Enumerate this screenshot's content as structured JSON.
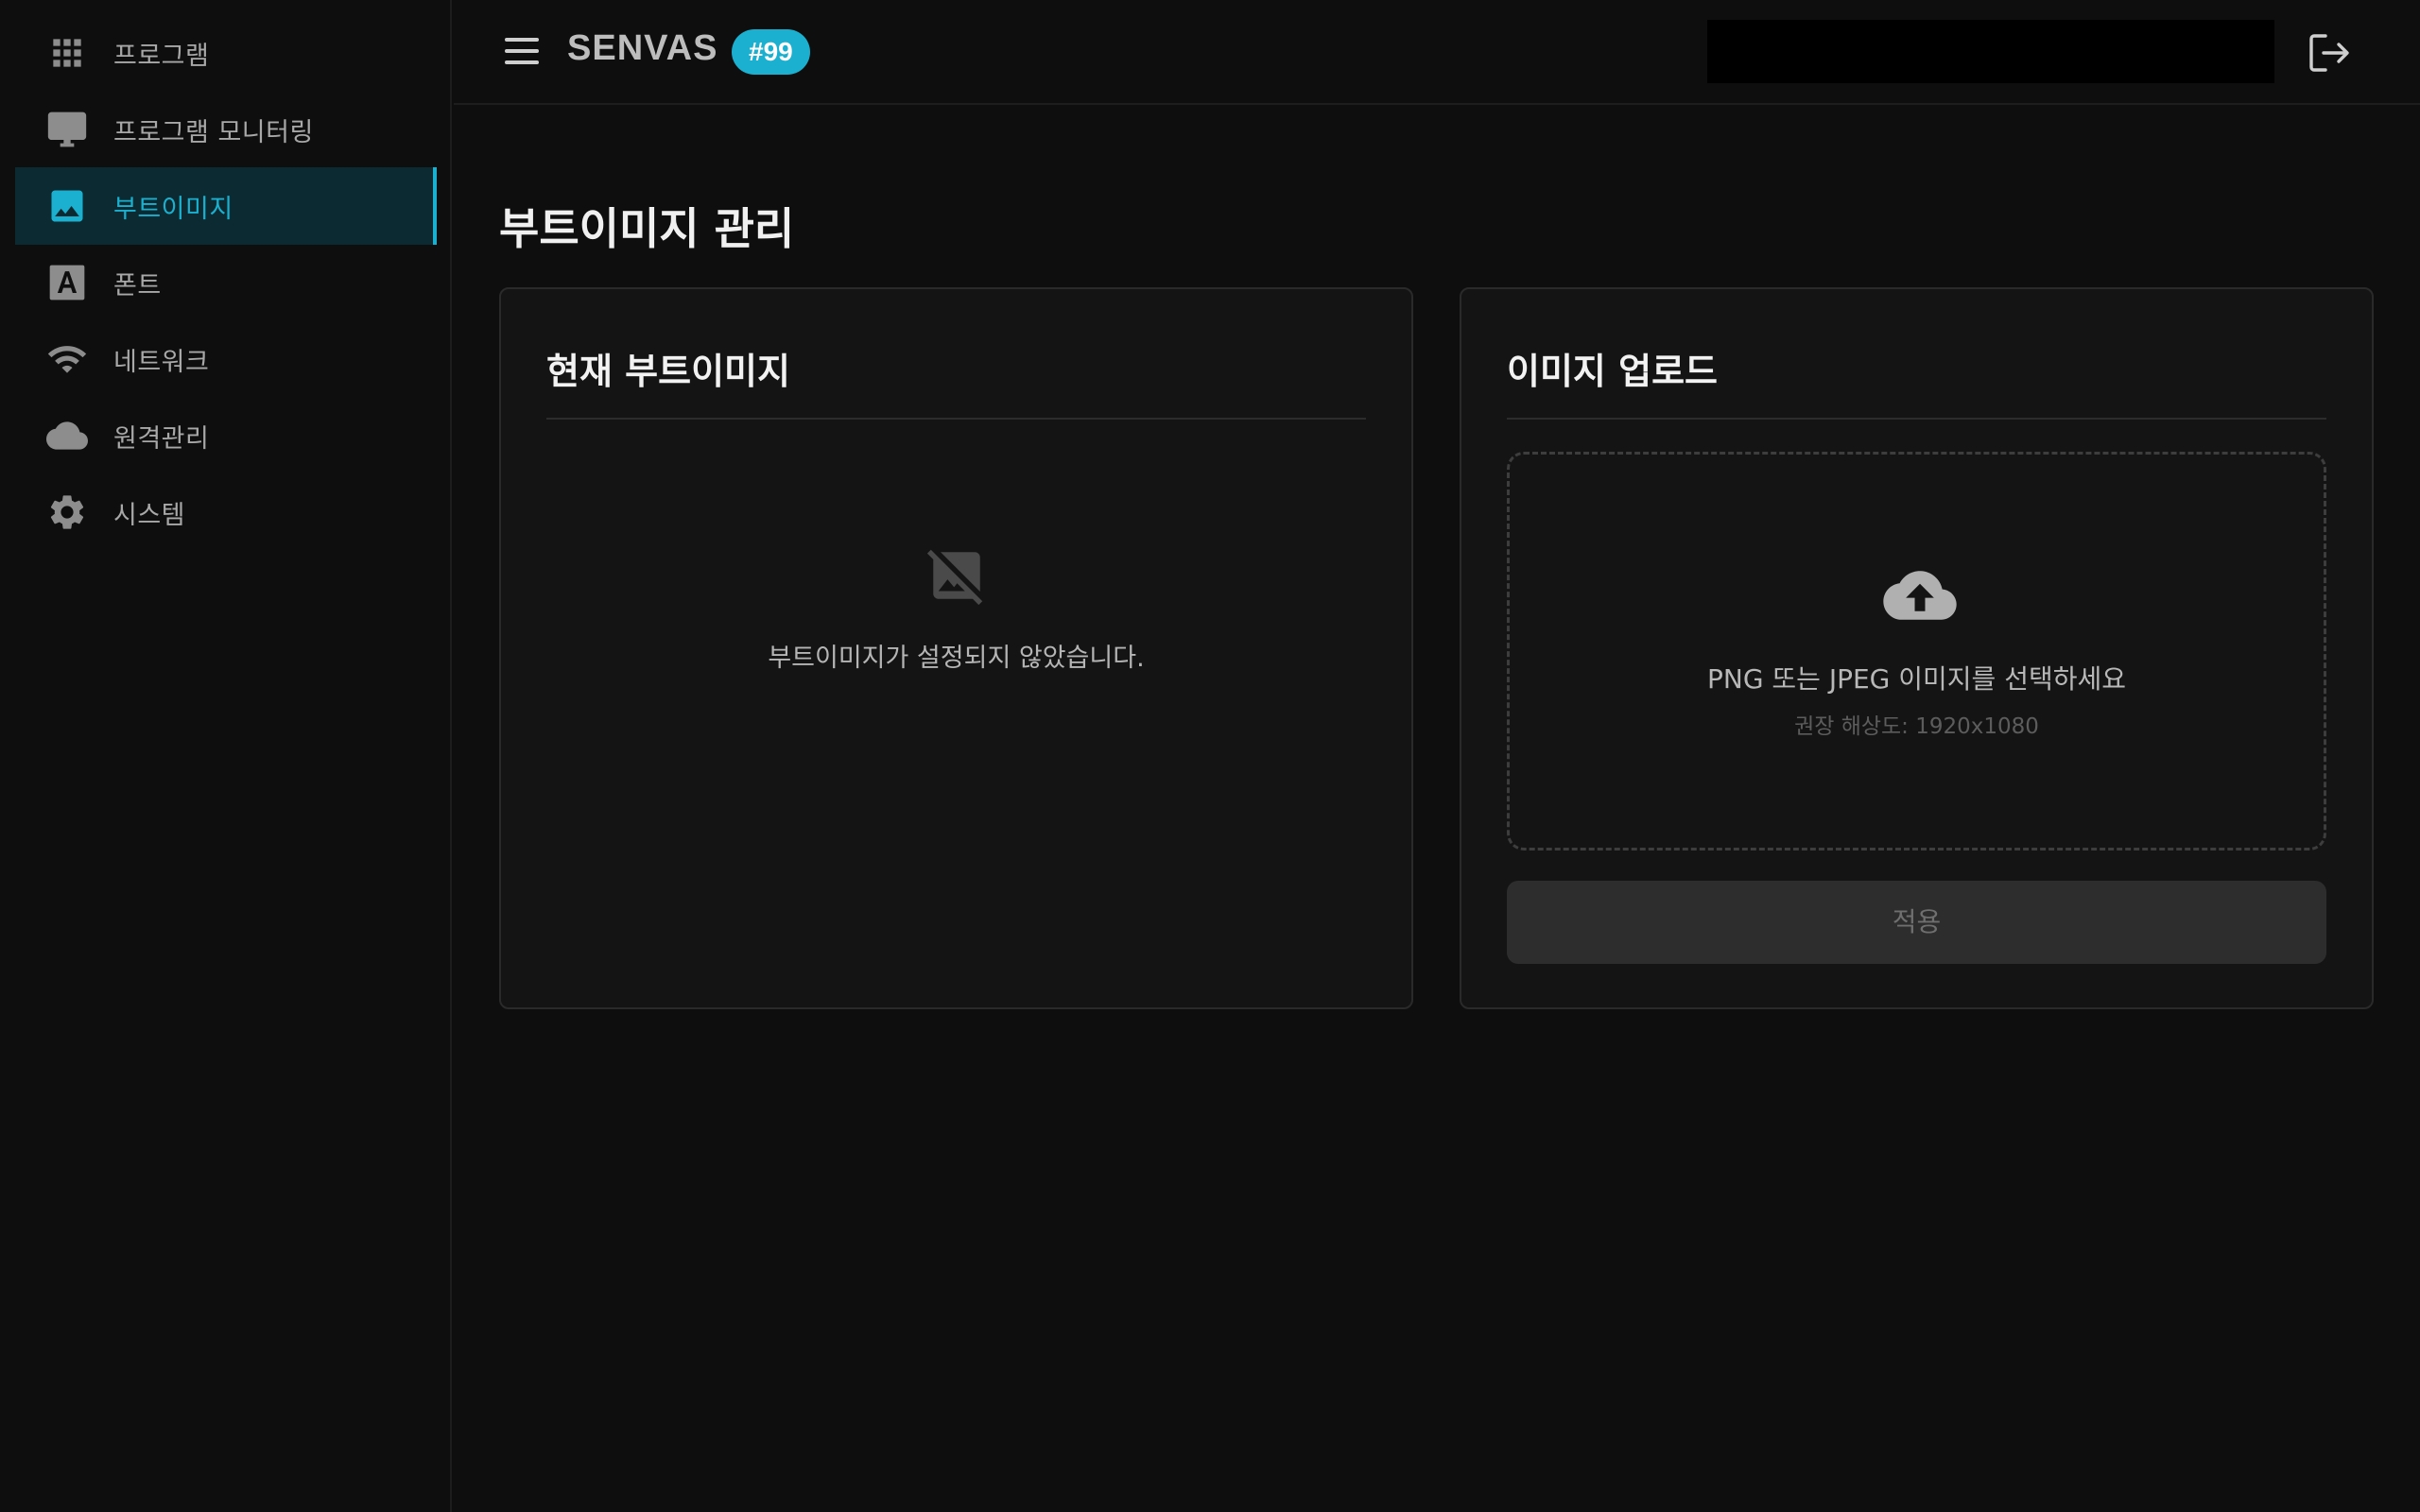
{
  "colors": {
    "accent": "#1bb0cf",
    "background": "#0e0e0e",
    "card": "#141414",
    "redacted": "#000000"
  },
  "sidebar": {
    "items": [
      {
        "label": "프로그램",
        "icon": "apps-grid-icon",
        "active": false
      },
      {
        "label": "프로그램 모니터링",
        "icon": "monitor-icon",
        "active": false
      },
      {
        "label": "부트이미지",
        "icon": "image-icon",
        "active": true
      },
      {
        "label": "폰트",
        "icon": "font-icon",
        "active": false
      },
      {
        "label": "네트워크",
        "icon": "wifi-icon",
        "active": false
      },
      {
        "label": "원격관리",
        "icon": "cloud-icon",
        "active": false
      },
      {
        "label": "시스템",
        "icon": "gear-icon",
        "active": false
      }
    ]
  },
  "header": {
    "menu_icon": "hamburger-menu-icon",
    "brand": "SENVAS",
    "badge": "#99",
    "logout_icon": "logout-icon"
  },
  "main": {
    "title": "부트이미지 관리",
    "current_card": {
      "title": "현재 부트이미지",
      "empty_icon": "image-not-supported-icon",
      "empty_text": "부트이미지가 설정되지 않았습니다."
    },
    "upload_card": {
      "title": "이미지 업로드",
      "upload_icon": "cloud-upload-icon",
      "instruction": "PNG 또는 JPEG 이미지를 선택하세요",
      "hint": "권장 해상도: 1920x1080",
      "apply_label": "적용"
    }
  }
}
